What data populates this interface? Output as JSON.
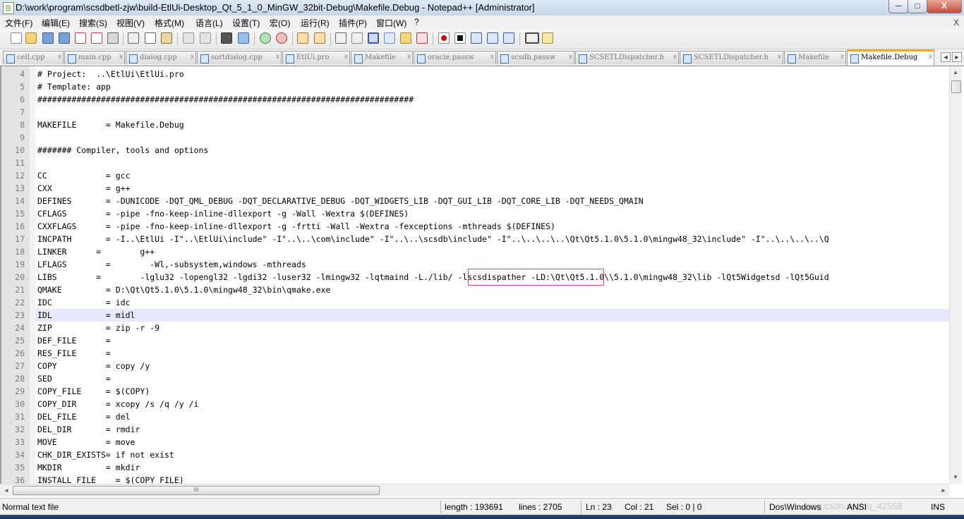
{
  "window": {
    "title": "D:\\work\\program\\scsdbetl-zjw\\build-EtlUi-Desktop_Qt_5_1_0_MinGW_32bit-Debug\\Makefile.Debug - Notepad++ [Administrator]",
    "minimize_glyph": "─",
    "maximize_glyph": "□",
    "close_glyph": "X"
  },
  "menu": {
    "items": [
      "文件(F)",
      "编辑(E)",
      "搜索(S)",
      "视图(V)",
      "格式(M)",
      "语言(L)",
      "设置(T)",
      "宏(O)",
      "运行(R)",
      "插件(P)",
      "窗口(W)",
      "?"
    ],
    "close_glyph": "X"
  },
  "toolbar": {
    "icons": [
      "new-file-icon",
      "open-file-icon",
      "save-icon",
      "save-all-icon",
      "close-icon",
      "close-all-icon",
      "print-icon",
      "cut-icon",
      "copy-icon",
      "paste-icon",
      "undo-icon",
      "redo-icon",
      "find-icon",
      "replace-icon",
      "zoom-in-icon",
      "zoom-out-icon",
      "sync-v-icon",
      "sync-h-icon",
      "word-wrap-icon",
      "show-all-chars-icon",
      "indent-guide-icon",
      "lang-icon",
      "doc-map-icon",
      "function-list-icon",
      "folder-workspace-icon",
      "record-macro-icon",
      "stop-macro-icon",
      "play-macro-icon",
      "run-macro-multiple-icon",
      "save-macro-icon",
      "spell-check-icon",
      "trim-icon"
    ]
  },
  "tabs": [
    {
      "label": "cell.cpp"
    },
    {
      "label": "main.cpp"
    },
    {
      "label": "dialog.cpp"
    },
    {
      "label": "sortdialog.cpp"
    },
    {
      "label": "EtlUi.pro"
    },
    {
      "label": "Makefile"
    },
    {
      "label": "oracle.passw"
    },
    {
      "label": "scsdb.passw"
    },
    {
      "label": "SCSETLDispatcher.h"
    },
    {
      "label": "SCSETLDispatcher.h"
    },
    {
      "label": "Makefile"
    },
    {
      "label": "Makefile.Debug"
    }
  ],
  "tab_close_glyph": "x",
  "tab_nav": {
    "left": "◄",
    "right": "►"
  },
  "editor": {
    "current_line": "23",
    "lines": [
      {
        "n": "4",
        "text": "# Project:  ..\\EtlUi\\EtlUi.pro"
      },
      {
        "n": "5",
        "text": "# Template: app"
      },
      {
        "n": "6",
        "text": "#############################################################################"
      },
      {
        "n": "7",
        "text": ""
      },
      {
        "n": "8",
        "text": "MAKEFILE      = Makefile.Debug"
      },
      {
        "n": "9",
        "text": ""
      },
      {
        "n": "10",
        "text": "####### Compiler, tools and options"
      },
      {
        "n": "11",
        "text": ""
      },
      {
        "n": "12",
        "text": "CC            = gcc"
      },
      {
        "n": "13",
        "text": "CXX           = g++"
      },
      {
        "n": "14",
        "text": "DEFINES       = -DUNICODE -DQT_QML_DEBUG -DQT_DECLARATIVE_DEBUG -DQT_WIDGETS_LIB -DQT_GUI_LIB -DQT_CORE_LIB -DQT_NEEDS_QMAIN"
      },
      {
        "n": "15",
        "text": "CFLAGS        = -pipe -fno-keep-inline-dllexport -g -Wall -Wextra $(DEFINES)"
      },
      {
        "n": "16",
        "text": "CXXFLAGS      = -pipe -fno-keep-inline-dllexport -g -frtti -Wall -Wextra -fexceptions -mthreads $(DEFINES)"
      },
      {
        "n": "17",
        "text": "INCPATH       = -I..\\EtlUi -I\"..\\EtlUi\\include\" -I\"..\\..\\com\\include\" -I\"..\\..\\scsdb\\include\" -I\"..\\..\\..\\..\\Qt\\Qt5.1.0\\5.1.0\\mingw48_32\\include\" -I\"..\\..\\..\\..\\Q"
      },
      {
        "n": "18",
        "text": "LINKER      =        g++"
      },
      {
        "n": "19",
        "text": "LFLAGS        =        -Wl,-subsystem,windows -mthreads"
      },
      {
        "n": "20",
        "text": "LIBS        =        -lglu32 -lopengl32 -lgdi32 -luser32 -lmingw32 -lqtmaind -L./lib/ -lscsdispather -LD:\\Qt\\Qt5.1.0\\\\5.1.0\\mingw48_32\\lib -lQt5Widgetsd -lQt5Guid"
      },
      {
        "n": "21",
        "text": "QMAKE         = D:\\Qt\\Qt5.1.0\\5.1.0\\mingw48_32\\bin\\qmake.exe"
      },
      {
        "n": "22",
        "text": "IDC           = idc"
      },
      {
        "n": "23",
        "text": "IDL           = midl"
      },
      {
        "n": "24",
        "text": "ZIP           = zip -r -9"
      },
      {
        "n": "25",
        "text": "DEF_FILE      ="
      },
      {
        "n": "26",
        "text": "RES_FILE      ="
      },
      {
        "n": "27",
        "text": "COPY          = copy /y"
      },
      {
        "n": "28",
        "text": "SED           ="
      },
      {
        "n": "29",
        "text": "COPY_FILE     = $(COPY)"
      },
      {
        "n": "30",
        "text": "COPY_DIR      = xcopy /s /q /y /i"
      },
      {
        "n": "31",
        "text": "DEL_FILE      = del"
      },
      {
        "n": "32",
        "text": "DEL_DIR       = rmdir"
      },
      {
        "n": "33",
        "text": "MOVE          = move"
      },
      {
        "n": "34",
        "text": "CHK_DIR_EXISTS= if not exist"
      },
      {
        "n": "35",
        "text": "MKDIR         = mkdir"
      },
      {
        "n": "36",
        "text": "INSTALL_FILE    = $(COPY_FILE)"
      }
    ]
  },
  "scrollbar": {
    "h_thumb_glyph": "III",
    "up": "▲",
    "down": "▼",
    "left": "◄",
    "right": "►"
  },
  "status": {
    "file_type": "Normal text file",
    "length": "length : 193691",
    "lines": "lines : 2705",
    "ln": "Ln : 23",
    "col": "Col : 21",
    "sel": "Sel : 0 | 0",
    "eol": "Dos\\Windows",
    "encoding": "ANSI",
    "mode": "INS",
    "watermark": "blog.csdn.net/qq_42558"
  },
  "colors": {
    "active_tab_accent": "#f5a623",
    "current_line_bg": "#e8e8ff",
    "highlight_box": "#e83fb2"
  }
}
